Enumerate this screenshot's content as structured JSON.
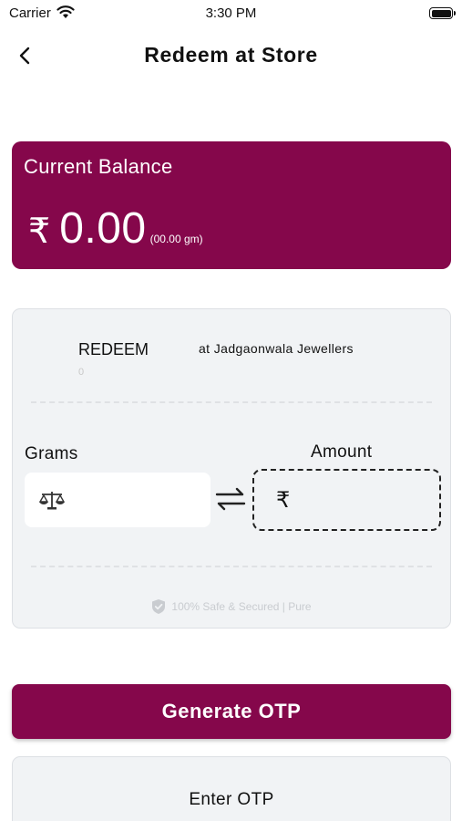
{
  "status_bar": {
    "carrier": "Carrier",
    "time": "3:30 PM",
    "icons": [
      "wifi-icon",
      "battery-icon"
    ]
  },
  "nav": {
    "title": "Redeem at Store",
    "back_icon": "chevron-left-icon"
  },
  "balance": {
    "title": "Current Balance",
    "currency_symbol": "₹",
    "amount": "0.00",
    "grams": "(00.00 gm)"
  },
  "redeem": {
    "label": "REDEEM",
    "sub_value": "0",
    "store": "at Jadgaonwala Jewellers",
    "grams_label": "Grams",
    "amount_label": "Amount",
    "grams_icon": "scale-icon",
    "swap_icon": "swap-arrows-icon",
    "amount_currency": "₹",
    "secure_text": "100% Safe & Secured | Pure",
    "secure_icon": "shield-check-icon"
  },
  "actions": {
    "generate_otp": "Generate OTP",
    "enter_otp": "Enter OTP"
  },
  "colors": {
    "brand": "#85074b",
    "card_bg": "#f1f3f5"
  }
}
